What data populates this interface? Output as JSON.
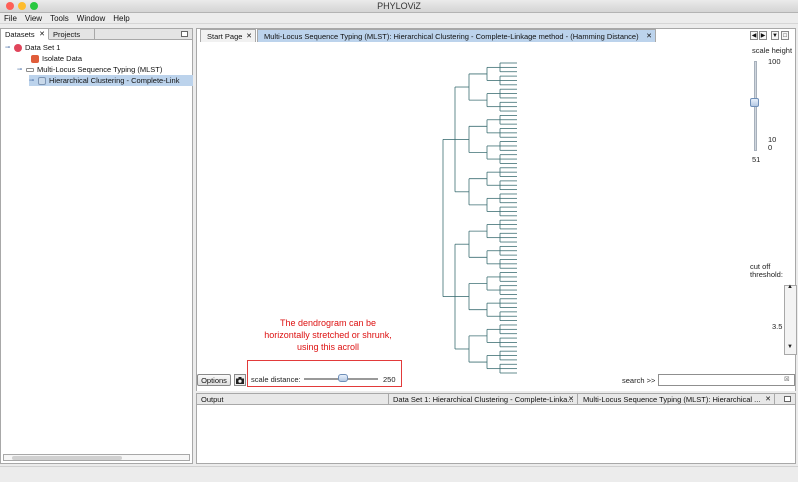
{
  "window": {
    "title": "PHYLOViZ",
    "controls": [
      "close",
      "minimize",
      "zoom"
    ],
    "colors": {
      "close": "#fe5f57",
      "minimize": "#febc2e",
      "zoom": "#28c840"
    }
  },
  "menu": [
    "File",
    "View",
    "Tools",
    "Window",
    "Help"
  ],
  "left_panel": {
    "tabs": [
      {
        "label": "Datasets",
        "active": true,
        "closable": true
      },
      {
        "label": "Projects",
        "active": false,
        "closable": false
      }
    ],
    "tree": [
      {
        "label": "Data Set 1",
        "icon": "dataset-icon",
        "expanded": true
      },
      {
        "label": "Isolate Data",
        "icon": "isolate-data-icon"
      },
      {
        "label": "Multi-Locus Sequence Typing (MLST)",
        "icon": "mlst-icon",
        "expanded": true
      },
      {
        "label": "Hierarchical Clustering  - Complete-Link",
        "icon": "clustering-icon",
        "selected": true
      }
    ]
  },
  "editor": {
    "tabs": [
      {
        "label": "Start Page",
        "closable": true,
        "active": false
      },
      {
        "label": "Multi-Locus Sequence Typing (MLST): Hierarchical Clustering  - Complete-Linkage method - (Hamming Distance)",
        "closable": true,
        "active": true
      }
    ],
    "scale_height": {
      "label": "scale height",
      "ticks": [
        "100",
        "10",
        "0"
      ],
      "value": "51",
      "level_percent": 51
    },
    "cut_off": {
      "label_line1": "cut off",
      "label_line2": "threshold:",
      "value": "3.5"
    },
    "options_label": "Options",
    "scale_distance": {
      "label": "scale distance:",
      "value": "250",
      "level_percent": 48
    },
    "search_label": "search >>",
    "search_value": "",
    "annotation": "The dendrogram can be horizontally stretched or shrunk, using this acroll",
    "annotation_color": "#d11111",
    "dendrogram_leaf_count": 72
  },
  "output_panel": {
    "label": "Output",
    "tabs": [
      {
        "label": "Data Set 1: Hierarchical Clustering  - Complete-Linka...",
        "closable": true
      },
      {
        "label": "Multi-Locus Sequence Typing (MLST): Hierarchical ...",
        "closable": true
      }
    ]
  }
}
